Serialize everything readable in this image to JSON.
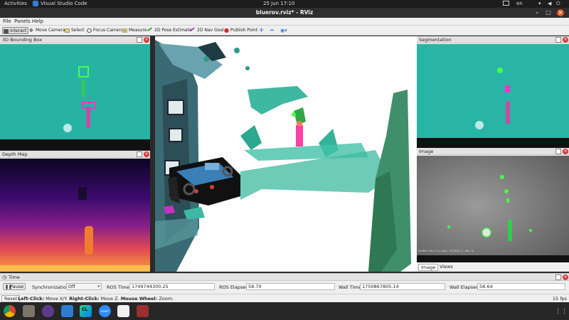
{
  "topbar": {
    "activities": "Activities",
    "app_name": "Visual Studio Code",
    "clock": "25 Jun  17:10",
    "lang": "en"
  },
  "window": {
    "title": "bluerov.rviz* - RViz"
  },
  "menu": {
    "file": "File",
    "panels": "Panels",
    "help": "Help"
  },
  "toolbar": {
    "interact": "Interact",
    "move_camera": "Move Camera",
    "select": "Select",
    "focus_camera": "Focus Camera",
    "measure": "Measure",
    "pose_estimate": "2D Pose Estimate",
    "nav_goal": "2D Nav Goal",
    "publish_point": "Publish Point"
  },
  "panels": {
    "bbox": {
      "title": "3D Bounding Box"
    },
    "depth": {
      "title": "Depth Map"
    },
    "segmentation": {
      "title": "Segmentation"
    },
    "image": {
      "title": "Image",
      "overlay_text": "Rx48fTn   Ms-/ 7v-b 7g2c. %G3Lg7-4 .  cBo ?-5"
    },
    "image_tabs": [
      "Image",
      "Views"
    ]
  },
  "time": {
    "title": "Time",
    "pause": "Pause",
    "sync_label": "Synchronization:",
    "sync_value": "Off",
    "ros_time_label": "ROS Time:",
    "ros_time": "1749744300.25",
    "ros_elapsed_label": "ROS Elapsed:",
    "ros_elapsed": "58.70",
    "wall_time_label": "Wall Time:",
    "wall_time": "1750867805.14",
    "wall_elapsed_label": "Wall Elapsed:",
    "wall_elapsed": "58.64"
  },
  "status": {
    "reset": "Reset",
    "left_click_label": "Left-Click:",
    "left_click_text": "Move X/Y.",
    "right_click_label": "Right-Click:",
    "right_click_text": "Move Z.",
    "wheel_label": "Mouse Wheel:",
    "wheel_text": "Zoom.",
    "fps": "15 fps"
  },
  "dock": [
    "chrome-icon",
    "files-icon",
    "tor-icon",
    "vscode-icon",
    "clion-icon",
    "zoom-icon",
    "editor-icon",
    "terminal-icon"
  ],
  "colors": {
    "accent": "#e95420",
    "highlight_green": "#44ff44",
    "highlight_magenta": "#ff33cc"
  }
}
